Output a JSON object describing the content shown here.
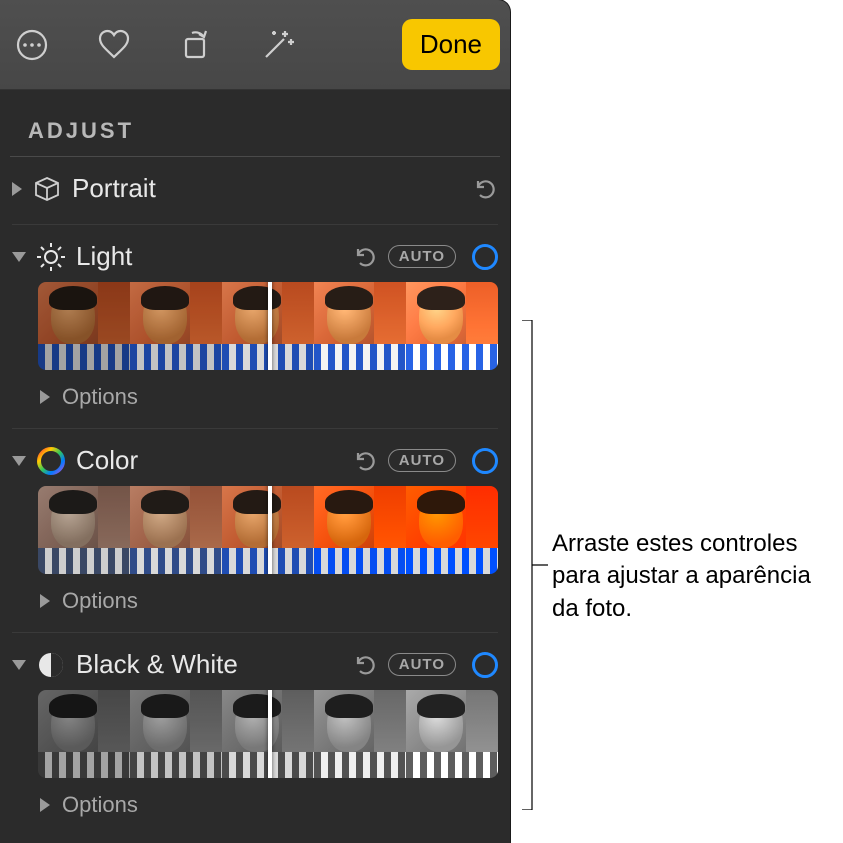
{
  "toolbar": {
    "done_label": "Done"
  },
  "section_title": "ADJUST",
  "adjustments": {
    "portrait": {
      "label": "Portrait"
    },
    "light": {
      "label": "Light",
      "auto": "AUTO",
      "options": "Options"
    },
    "color": {
      "label": "Color",
      "auto": "AUTO",
      "options": "Options"
    },
    "bw": {
      "label": "Black & White",
      "auto": "AUTO",
      "options": "Options"
    }
  },
  "callout": {
    "text": "Arraste estes controles para ajustar a aparência da foto."
  }
}
